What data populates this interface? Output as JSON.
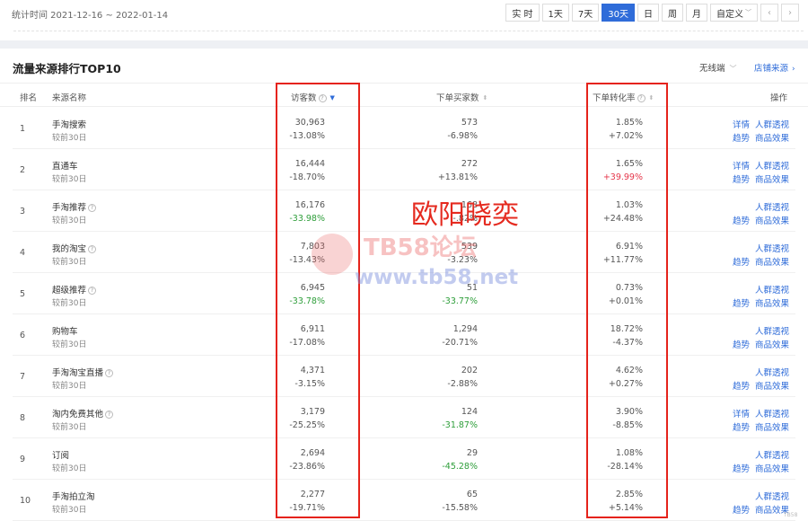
{
  "header": {
    "stat_time": "统计时间 2021-12-16 ~ 2022-01-14",
    "periods": [
      "实 时",
      "1天",
      "7天",
      "30天",
      "日",
      "周",
      "月",
      "自定义"
    ],
    "active_period_index": 3,
    "nav_prev": "‹",
    "nav_next": "›"
  },
  "panel": {
    "title": "流量来源排行TOP10",
    "device_select": "无线端",
    "shop_source": "店铺来源"
  },
  "columns": {
    "rank": "排名",
    "source": "来源名称",
    "visitors": "访客数",
    "buyers": "下单买家数",
    "conversion": "下单转化率",
    "actions": "操作"
  },
  "icons": {
    "help": "?",
    "sort_desc": "▼",
    "sort_both": "⬍",
    "chevron_down": "﹀",
    "chevron_right": "›"
  },
  "rows": [
    {
      "rank": "1",
      "name": "手淘搜索",
      "help": false,
      "sub": "较前30日",
      "visitors": "30,963",
      "visitors_change": "-13.08%",
      "visitors_color": "normal",
      "buyers": "573",
      "buyers_change": "-6.98%",
      "buyers_color": "normal",
      "cvr": "1.85%",
      "cvr_change": "+7.02%",
      "cvr_color": "normal",
      "actions": [
        "详情",
        "人群透视",
        "趋势",
        "商品效果"
      ]
    },
    {
      "rank": "2",
      "name": "直通车",
      "help": false,
      "sub": "较前30日",
      "visitors": "16,444",
      "visitors_change": "-18.70%",
      "visitors_color": "normal",
      "buyers": "272",
      "buyers_change": "+13.81%",
      "buyers_color": "normal",
      "cvr": "1.65%",
      "cvr_change": "+39.99%",
      "cvr_color": "red",
      "actions": [
        "详情",
        "人群透视",
        "趋势",
        "商品效果"
      ]
    },
    {
      "rank": "3",
      "name": "手淘推荐",
      "help": true,
      "sub": "较前30日",
      "visitors": "16,176",
      "visitors_change": "-33.98%",
      "visitors_color": "green",
      "buyers": "168",
      "buyers_change": "-.82%",
      "buyers_color": "normal",
      "cvr": "1.03%",
      "cvr_change": "+24.48%",
      "cvr_color": "normal",
      "actions": [
        "",
        "人群透视",
        "趋势",
        "商品效果"
      ]
    },
    {
      "rank": "4",
      "name": "我的淘宝",
      "help": true,
      "sub": "较前30日",
      "visitors": "7,803",
      "visitors_change": "-13.43%",
      "visitors_color": "normal",
      "buyers": "539",
      "buyers_change": "-3.23%",
      "buyers_color": "normal",
      "cvr": "6.91%",
      "cvr_change": "+11.77%",
      "cvr_color": "normal",
      "actions": [
        "",
        "人群透视",
        "趋势",
        "商品效果"
      ]
    },
    {
      "rank": "5",
      "name": "超级推荐",
      "help": true,
      "sub": "较前30日",
      "visitors": "6,945",
      "visitors_change": "-33.78%",
      "visitors_color": "green",
      "buyers": "51",
      "buyers_change": "-33.77%",
      "buyers_color": "green",
      "cvr": "0.73%",
      "cvr_change": "+0.01%",
      "cvr_color": "normal",
      "actions": [
        "",
        "人群透视",
        "趋势",
        "商品效果"
      ]
    },
    {
      "rank": "6",
      "name": "购物车",
      "help": false,
      "sub": "较前30日",
      "visitors": "6,911",
      "visitors_change": "-17.08%",
      "visitors_color": "normal",
      "buyers": "1,294",
      "buyers_change": "-20.71%",
      "buyers_color": "normal",
      "cvr": "18.72%",
      "cvr_change": "-4.37%",
      "cvr_color": "normal",
      "actions": [
        "",
        "人群透视",
        "趋势",
        "商品效果"
      ]
    },
    {
      "rank": "7",
      "name": "手淘淘宝直播",
      "help": true,
      "sub": "较前30日",
      "visitors": "4,371",
      "visitors_change": "-3.15%",
      "visitors_color": "normal",
      "buyers": "202",
      "buyers_change": "-2.88%",
      "buyers_color": "normal",
      "cvr": "4.62%",
      "cvr_change": "+0.27%",
      "cvr_color": "normal",
      "actions": [
        "",
        "人群透视",
        "趋势",
        "商品效果"
      ]
    },
    {
      "rank": "8",
      "name": "淘内免费其他",
      "help": true,
      "sub": "较前30日",
      "visitors": "3,179",
      "visitors_change": "-25.25%",
      "visitors_color": "normal",
      "buyers": "124",
      "buyers_change": "-31.87%",
      "buyers_color": "green",
      "cvr": "3.90%",
      "cvr_change": "-8.85%",
      "cvr_color": "normal",
      "actions": [
        "详情",
        "人群透视",
        "趋势",
        "商品效果"
      ]
    },
    {
      "rank": "9",
      "name": "订阅",
      "help": false,
      "sub": "较前30日",
      "visitors": "2,694",
      "visitors_change": "-23.86%",
      "visitors_color": "normal",
      "buyers": "29",
      "buyers_change": "-45.28%",
      "buyers_color": "green",
      "cvr": "1.08%",
      "cvr_change": "-28.14%",
      "cvr_color": "normal",
      "actions": [
        "",
        "人群透视",
        "趋势",
        "商品效果"
      ]
    },
    {
      "rank": "10",
      "name": "手淘拍立淘",
      "help": false,
      "sub": "较前30日",
      "visitors": "2,277",
      "visitors_change": "-19.71%",
      "visitors_color": "normal",
      "buyers": "65",
      "buyers_change": "-15.58%",
      "buyers_color": "normal",
      "cvr": "2.85%",
      "cvr_change": "+5.14%",
      "cvr_color": "normal",
      "actions": [
        "",
        "人群透视",
        "趋势",
        "商品效果"
      ]
    }
  ],
  "overlay": {
    "name": "欧阳晓奕",
    "watermark_text": "TB58论坛",
    "watermark_url": "www.tb58.net",
    "corner_mark": "TB58"
  },
  "colors": {
    "accent": "#2f6cd9",
    "negative_green": "#2e9e3a",
    "positive_red": "#e5374b",
    "highlight_box": "#e5231b"
  }
}
